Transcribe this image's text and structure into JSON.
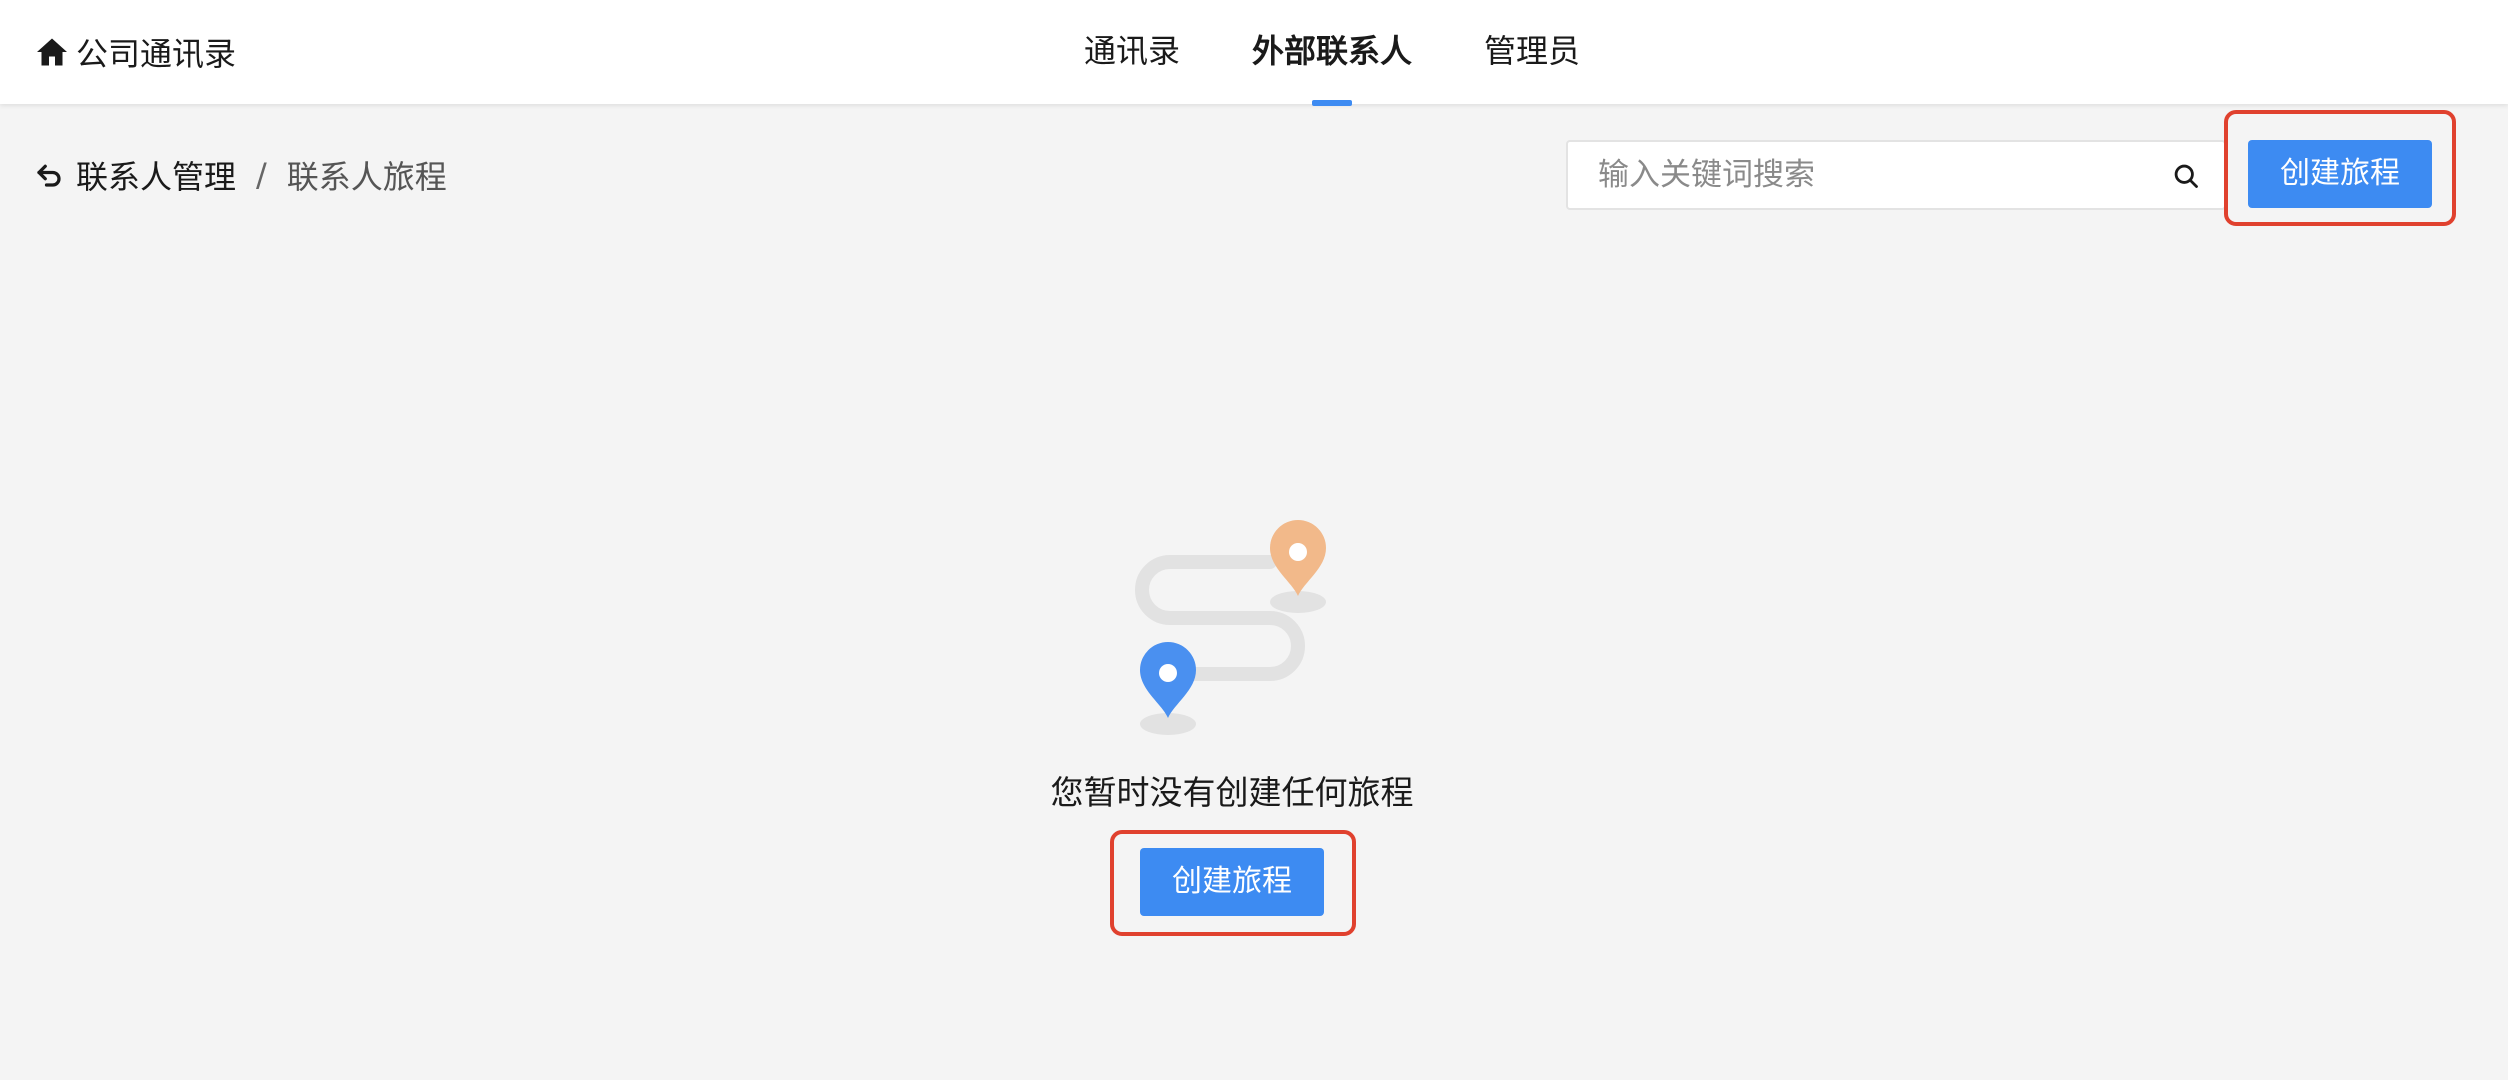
{
  "header": {
    "brand_icon": "home-icon",
    "brand": "公司通讯录",
    "tabs": [
      {
        "label": "通讯录",
        "active": false
      },
      {
        "label": "外部联系人",
        "active": true
      },
      {
        "label": "管理员",
        "active": false
      }
    ]
  },
  "breadcrumb": {
    "back_icon": "back-arrow-icon",
    "parent": "联系人管理",
    "separator": "/",
    "current": "联系人旅程"
  },
  "search": {
    "placeholder": "输入关键词搜索",
    "value": "",
    "icon": "search-icon"
  },
  "actions": {
    "create_label": "创建旅程"
  },
  "empty_state": {
    "icon": "journey-route-icon",
    "message": "您暂时没有创建任何旅程",
    "button_label": "创建旅程"
  },
  "colors": {
    "primary": "#3d8bf2",
    "highlight": "#e0412e",
    "pin_start": "#4a90f0",
    "pin_end": "#f2b98a",
    "background": "#f4f4f4"
  }
}
